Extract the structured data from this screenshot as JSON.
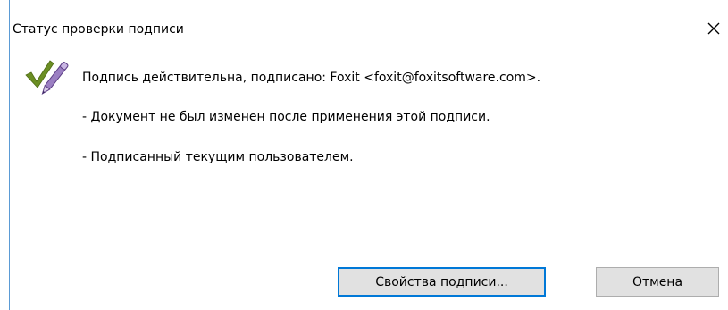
{
  "dialog": {
    "title": "Статус проверки подписи",
    "close_symbol": "✕",
    "icon": "signature-valid-icon"
  },
  "message": {
    "line1": "Подпись действительна, подписано: Foxit <foxit@foxitsoftware.com>.",
    "line2": "- Документ не был изменен после применения этой подписи.",
    "line3": "- Подписанный текущим пользователем."
  },
  "buttons": {
    "properties_label": "Свойства подписи...",
    "cancel_label": "Отмена"
  },
  "colors": {
    "focus_border": "#0078d7",
    "check_green": "#6b8e23",
    "pen_purple": "#8a6bb0",
    "button_bg": "#e1e1e1"
  }
}
